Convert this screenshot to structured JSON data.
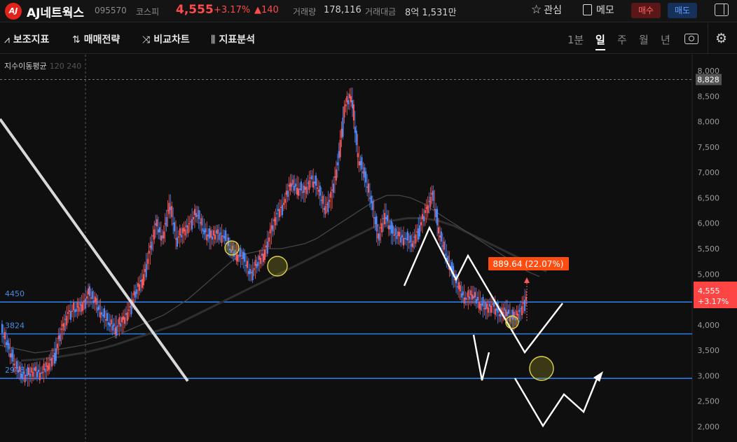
{
  "header": {
    "logo_text": "AJ",
    "stock_name": "AJ네트웍스",
    "stock_code": "095570",
    "market": "코스피",
    "price": "4,555",
    "change_pct": "+3.17%",
    "change_val": "▲140",
    "volume_label": "거래량",
    "volume_value": "178,116",
    "amount_label": "거래대금",
    "amount_value": "8억 1,531만",
    "favorite_label": "관심",
    "memo_label": "메모",
    "buy_label": "매수",
    "sell_label": "매도"
  },
  "toolbar": {
    "tools": [
      {
        "label": "보조지표",
        "icon": "indicator-icon"
      },
      {
        "label": "매매전략",
        "icon": "strategy-icon"
      },
      {
        "label": "비교차트",
        "icon": "compare-icon"
      },
      {
        "label": "지표분석",
        "icon": "analysis-icon"
      }
    ],
    "periods": [
      "1분",
      "일",
      "주",
      "월",
      "년"
    ],
    "active_period": "일"
  },
  "chart": {
    "ma_label": "지수이동평균",
    "ma_periods": "120 240",
    "annotation": "889.64 (22.07%)",
    "price_tag": "4,555",
    "price_tag_change": "+3.17%",
    "crosshair_price": "8,828",
    "level_labels": [
      "4450",
      "3824",
      "2948"
    ],
    "colors": {
      "up": "#ff5a5a",
      "down": "#4f8cff",
      "level_line": "#2e7be6",
      "annotation_bg": "#ff4d12"
    }
  },
  "chart_data": {
    "type": "line",
    "yticks": [
      "8,000",
      "8,500",
      "8,000",
      "7,500",
      "7,000",
      "6,500",
      "6,000",
      "5,500",
      "5,000",
      "4,500",
      "4,000",
      "3,500",
      "3,000",
      "2,500",
      "2,000"
    ],
    "yvalues": [
      9000,
      8500,
      8000,
      7500,
      7000,
      6500,
      6000,
      5500,
      5000,
      4500,
      4000,
      3500,
      3000,
      2500,
      2000
    ],
    "ylim": [
      1850,
      9200
    ],
    "horizontal_levels": [
      4450,
      3824,
      2948
    ],
    "crosshair_level": 8828,
    "price_series": [
      3900,
      3600,
      3200,
      3050,
      3000,
      3100,
      3050,
      3200,
      3450,
      3900,
      4250,
      4300,
      4400,
      4600,
      4450,
      4200,
      4050,
      3950,
      4050,
      4300,
      4650,
      4900,
      5400,
      6000,
      5700,
      6400,
      5700,
      5800,
      6000,
      6200,
      5900,
      5700,
      5800,
      5750,
      5500,
      5400,
      5300,
      5000,
      5200,
      5400,
      5800,
      6200,
      6400,
      6800,
      6700,
      6600,
      6900,
      6700,
      6300,
      6500,
      7200,
      8300,
      8500,
      7300,
      6900,
      6400,
      5700,
      6200,
      5800,
      5750,
      5700,
      5600,
      5900,
      6200,
      6600,
      5800,
      5400,
      5000,
      4700,
      4500,
      4600,
      4450,
      4300,
      4400,
      4200,
      4300,
      4100,
      4250,
      4555
    ],
    "ma120": [
      3600,
      3550,
      3500,
      3450,
      3480,
      3520,
      3560,
      3600,
      3650,
      3700,
      3800,
      3900,
      4000,
      4100,
      4200,
      4350,
      4500,
      4700,
      4900,
      5100,
      5300,
      5400,
      5450,
      5500,
      5500,
      5550,
      5600,
      5700,
      5850,
      6000,
      6150,
      6300,
      6450,
      6550,
      6550,
      6500,
      6400,
      6250,
      6100,
      5950,
      5800,
      5650,
      5500,
      5350,
      5200,
      5050,
      4950
    ],
    "ma240": [
      3300,
      3320,
      3350,
      3400,
      3450,
      3520,
      3600,
      3700,
      3800,
      3900,
      4000,
      4150,
      4300,
      4450,
      4600,
      4750,
      4900,
      5050,
      5200,
      5350,
      5500,
      5650,
      5800,
      5950,
      6050,
      6100,
      6100,
      6050,
      5950,
      5800,
      5650,
      5500,
      5350,
      5200,
      5050
    ],
    "projection_upper": [
      [
        6000,
        0
      ],
      [
        7000,
        1
      ],
      [
        6000,
        2
      ],
      [
        6500,
        3
      ],
      [
        4450,
        4
      ],
      [
        5500,
        5
      ]
    ],
    "projection_lower": [
      [
        4000,
        0
      ],
      [
        3000,
        1
      ],
      [
        3700,
        2
      ],
      [
        3350,
        3
      ],
      [
        4150,
        4
      ]
    ],
    "trendline": [
      [
        8000,
        0
      ],
      [
        2900,
        1
      ]
    ]
  }
}
